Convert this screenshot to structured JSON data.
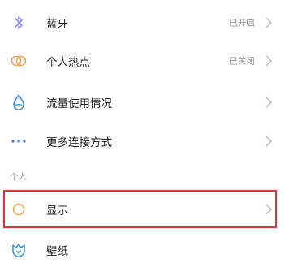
{
  "settings": {
    "items": [
      {
        "label": "蓝牙",
        "status": "已开启",
        "icon": "bluetooth-icon"
      },
      {
        "label": "个人热点",
        "status": "已关闭",
        "icon": "hotspot-icon"
      },
      {
        "label": "流量使用情况",
        "status": "",
        "icon": "data-usage-icon"
      },
      {
        "label": "更多连接方式",
        "status": "",
        "icon": "more-connections-icon"
      }
    ],
    "section_personal": "个人",
    "personal_items": [
      {
        "label": "显示",
        "icon": "display-icon"
      },
      {
        "label": "壁纸",
        "icon": "wallpaper-icon"
      }
    ]
  },
  "colors": {
    "bluetooth": "#8f8ff0",
    "hotspot": "#f0a24a",
    "data_usage": "#3f8fd8",
    "more": "#4a73d8",
    "display": "#f0a24a",
    "wallpaper": "#3f8fd8",
    "highlight_border": "#d9373b"
  }
}
